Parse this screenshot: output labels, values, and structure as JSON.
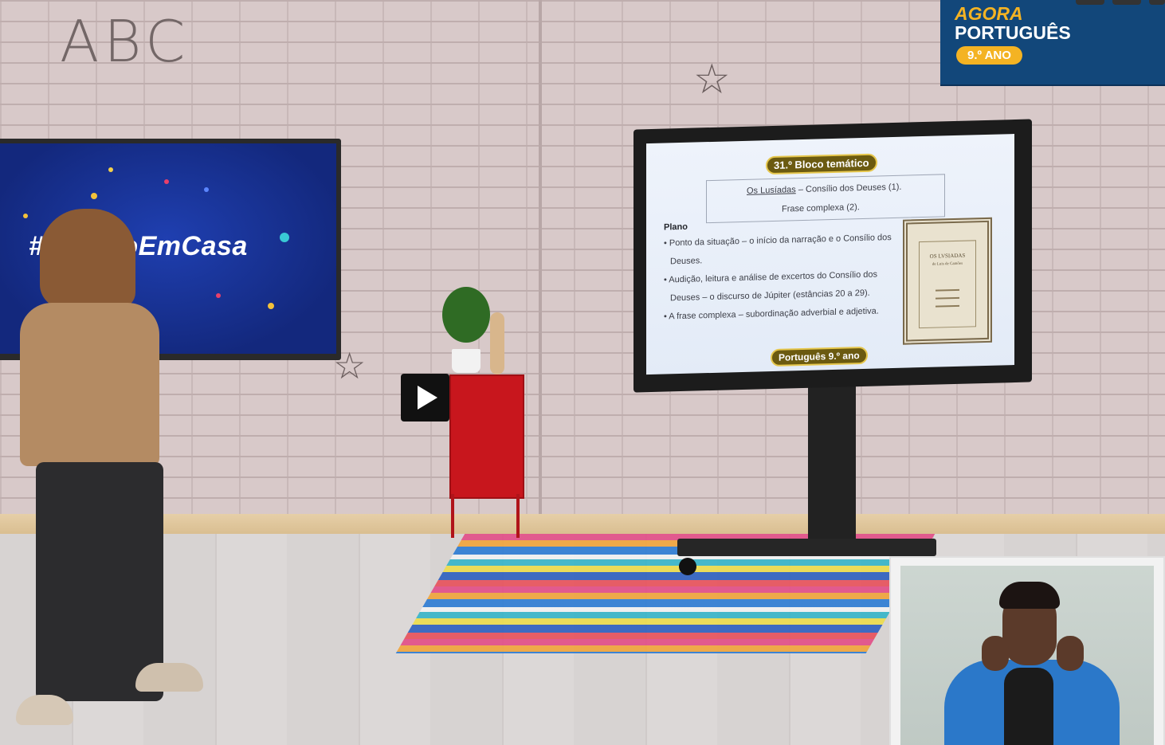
{
  "video": {
    "play_label": "Play video",
    "icon": "play-icon"
  },
  "left_screen": {
    "hashtag": "#EstudoEmCasa"
  },
  "wall": {
    "doodle_text": "ABC"
  },
  "slide": {
    "title": "31.º Bloco temático",
    "box_line1_underlined": "Os Lusíadas",
    "box_line1_rest": " – Consílio dos Deuses (1).",
    "box_line2": "Frase complexa (2).",
    "plan_heading": "Plano",
    "bullets": [
      "• Ponto da situação – o início da narração e o Consílio dos",
      "Deuses.",
      "• Audição, leitura e análise de excertos do Consílio dos",
      "Deuses – o discurso de Júpiter (estâncias 20 a 29).",
      "• A frase complexa – subordinação adverbial e adjetiva."
    ],
    "book_title_line1": "OS LVSIADAS",
    "book_title_line2": "de Luis de Camões",
    "footer": "Português 9.º ano"
  },
  "logo": {
    "line1": "AGORA",
    "line2": "PORTUGUÊS",
    "grade": "9.º ANO"
  },
  "colors": {
    "logo_bg": "#12477a",
    "logo_accent": "#f4b323",
    "left_screen_bg": "#1a35a0",
    "cabinet": "#c8161d"
  }
}
